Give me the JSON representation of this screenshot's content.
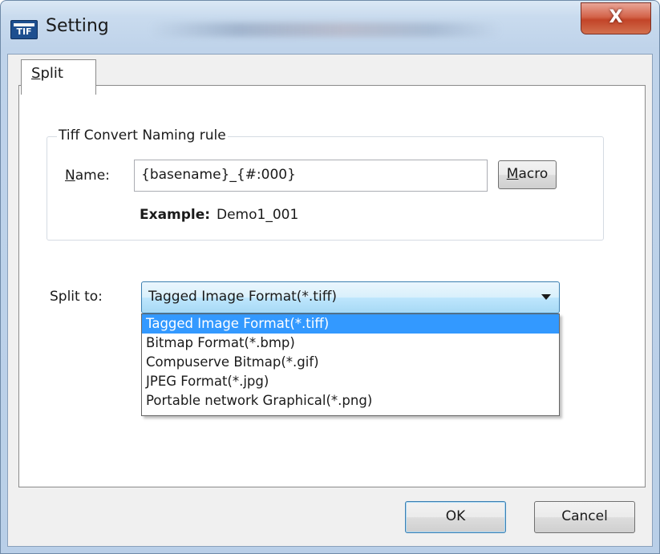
{
  "window": {
    "title": "Setting",
    "icon": "tif-file-icon",
    "close_label": "X"
  },
  "tabs": [
    {
      "label_underlined": "S",
      "label_rest": "plit",
      "selected": true
    }
  ],
  "naming_group": {
    "legend": "Tiff Convert Naming rule",
    "name_label_underlined": "N",
    "name_label_rest": "ame:",
    "name_value": "{basename}_{#:000}",
    "macro_underlined": "M",
    "macro_rest": "acro",
    "example_label": "Example:",
    "example_value": "Demo1_001"
  },
  "split": {
    "label": "Split to:",
    "selected_value": "Tagged Image Format(*.tiff)",
    "options": [
      "Tagged Image Format(*.tiff)",
      "Bitmap Format(*.bmp)",
      "Compuserve Bitmap(*.gif)",
      "JPEG Format(*.jpg)",
      "Portable network Graphical(*.png)"
    ],
    "highlighted_index": 0
  },
  "buttons": {
    "ok": "OK",
    "cancel": "Cancel"
  },
  "colors": {
    "selection": "#3399ff",
    "close_button": "#c24428",
    "focus_border": "#3c7fb1"
  }
}
